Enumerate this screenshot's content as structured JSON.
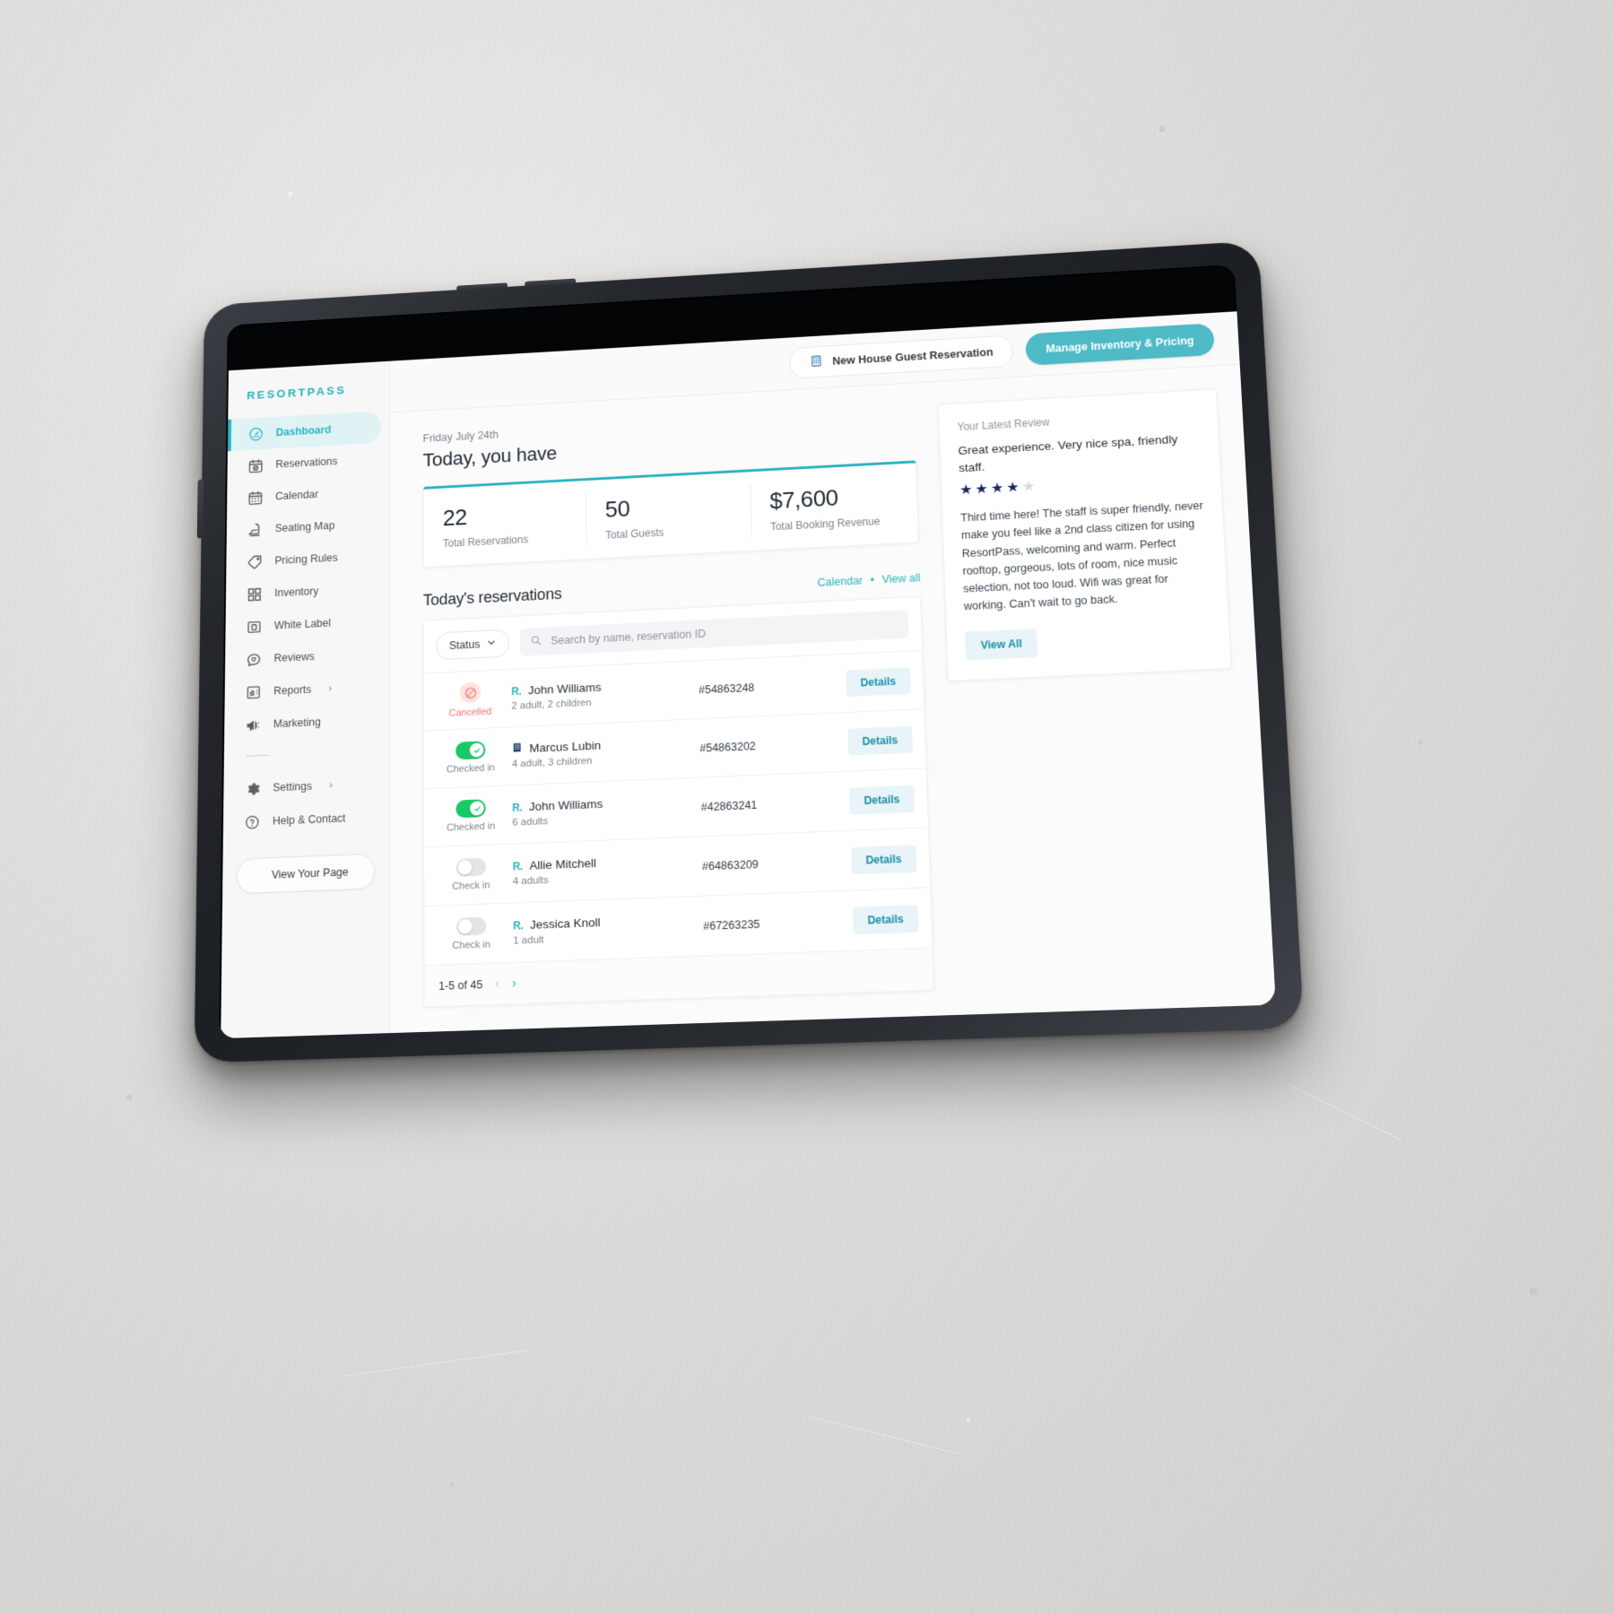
{
  "sidebar": {
    "brand": "RESORTPASS",
    "items": [
      {
        "label": "Dashboard",
        "icon": "gauge-icon",
        "active": true
      },
      {
        "label": "Reservations",
        "icon": "calendar-check-icon",
        "active": false
      },
      {
        "label": "Calendar",
        "icon": "calendar-icon",
        "active": false
      },
      {
        "label": "Seating Map",
        "icon": "lounge-chair-icon",
        "active": false
      },
      {
        "label": "Pricing Rules",
        "icon": "price-tag-icon",
        "active": false
      },
      {
        "label": "Inventory",
        "icon": "grid-icon",
        "active": false
      },
      {
        "label": "White Label",
        "icon": "browser-icon",
        "active": false
      },
      {
        "label": "Reviews",
        "icon": "heart-chat-icon",
        "active": false
      },
      {
        "label": "Reports",
        "icon": "report-chart-icon",
        "active": false,
        "chevron": "›"
      },
      {
        "label": "Marketing",
        "icon": "megaphone-icon",
        "active": false
      }
    ],
    "secondary": [
      {
        "label": "Settings",
        "icon": "gear-icon",
        "chevron": "›"
      },
      {
        "label": "Help & Contact",
        "icon": "question-circle-icon"
      }
    ],
    "view_page_button": {
      "label": "View Your Page",
      "icon": "eye-icon"
    }
  },
  "topbar": {
    "new_reservation_button": {
      "label": "New House Guest Reservation",
      "icon": "building-icon"
    },
    "manage_button": {
      "label": "Manage Inventory & Pricing"
    }
  },
  "overview": {
    "date": "Friday July 24th",
    "heading": "Today, you have",
    "stats": [
      {
        "value": "22",
        "label": "Total Reservations"
      },
      {
        "value": "50",
        "label": "Total Guests"
      },
      {
        "value": "$7,600",
        "label": "Total Booking Revenue"
      }
    ]
  },
  "reservations": {
    "section_title": "Today's reservations",
    "links": {
      "calendar": "Calendar",
      "separator": "•",
      "view_all": "View all"
    },
    "toolbar": {
      "status_filter_label": "Status",
      "status_chevron": "⌄",
      "search_placeholder": "Search by name, reservation ID",
      "search_value": ""
    },
    "rows": [
      {
        "status": "Cancelled",
        "status_type": "cancelled",
        "name": "John Williams",
        "guests": "2 adult, 2 children",
        "id": "#54863248",
        "action": "Details",
        "badge": "resortpass"
      },
      {
        "status": "Checked in",
        "status_type": "on",
        "name": "Marcus Lubin",
        "guests": "4 adult, 3 children",
        "id": "#54863202",
        "action": "Details",
        "badge": "house"
      },
      {
        "status": "Checked in",
        "status_type": "on",
        "name": "John Williams",
        "guests": "6 adults",
        "id": "#42863241",
        "action": "Details",
        "badge": "resortpass"
      },
      {
        "status": "Check in",
        "status_type": "off",
        "name": "Allie Mitchell",
        "guests": "4 adults",
        "id": "#64863209",
        "action": "Details",
        "badge": "resortpass"
      },
      {
        "status": "Check in",
        "status_type": "off",
        "name": "Jessica Knoll",
        "guests": "1 adult",
        "id": "#67263235",
        "action": "Details",
        "badge": "resortpass"
      }
    ],
    "pagination": {
      "range": "1-5 of 45",
      "prev": "‹",
      "next": "›"
    }
  },
  "review": {
    "label": "Your Latest Review",
    "title": "Great experience. Very nice spa, friendly staff.",
    "rating": 4,
    "max_rating": 5,
    "body": "Third time here! The staff is super friendly, never make you feel like a 2nd class citizen for using ResortPass, welcoming and warm. Perfect rooftop, gorgeous, lots of room, nice music selection, not too loud. Wifi was great for working. Can't wait to go back.",
    "view_all_button": "View All"
  },
  "colors": {
    "brand_teal": "#2bb3c0",
    "primary_button": "#4dbac6",
    "accent_light": "#dff3f5",
    "success_green": "#18c964",
    "danger_red": "#f4736f",
    "star_navy": "#16295c",
    "star_empty": "#d6d8da"
  }
}
